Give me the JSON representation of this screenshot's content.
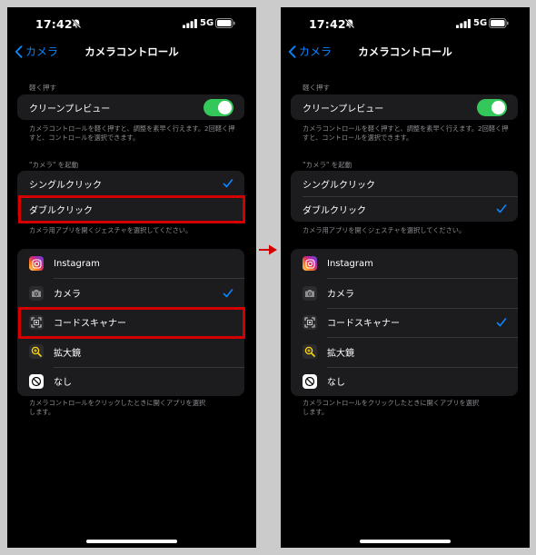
{
  "status": {
    "time": "17:42",
    "network": "5G"
  },
  "nav": {
    "back": "カメラ",
    "title": "カメラコントロール"
  },
  "light_press": {
    "label": "軽く押す",
    "clean_preview": "クリーンプレビュー",
    "footnote": "カメラコントロールを軽く押すと、調整を素早く行えます。2回軽く押すと、コントロールを選択できます。"
  },
  "launch": {
    "label": "\"カメラ\" を起動",
    "single_click": "シングルクリック",
    "double_click": "ダブルクリック",
    "footnote": "カメラ用アプリを開くジェスチャを選択してください。"
  },
  "apps": {
    "items": [
      {
        "label": "Instagram",
        "icon": "instagram-icon"
      },
      {
        "label": "カメラ",
        "icon": "camera-icon"
      },
      {
        "label": "コードスキャナー",
        "icon": "code-scanner-icon"
      },
      {
        "label": "拡大鏡",
        "icon": "magnifier-icon"
      },
      {
        "label": "なし",
        "icon": "none-icon"
      }
    ],
    "footnote": "カメラコントロールをクリックしたときに開くアプリを選択します。"
  },
  "colors": {
    "accent": "#0a84ff",
    "toggle_on": "#34c759",
    "highlight": "#d40000",
    "arrow": "#d40000"
  }
}
